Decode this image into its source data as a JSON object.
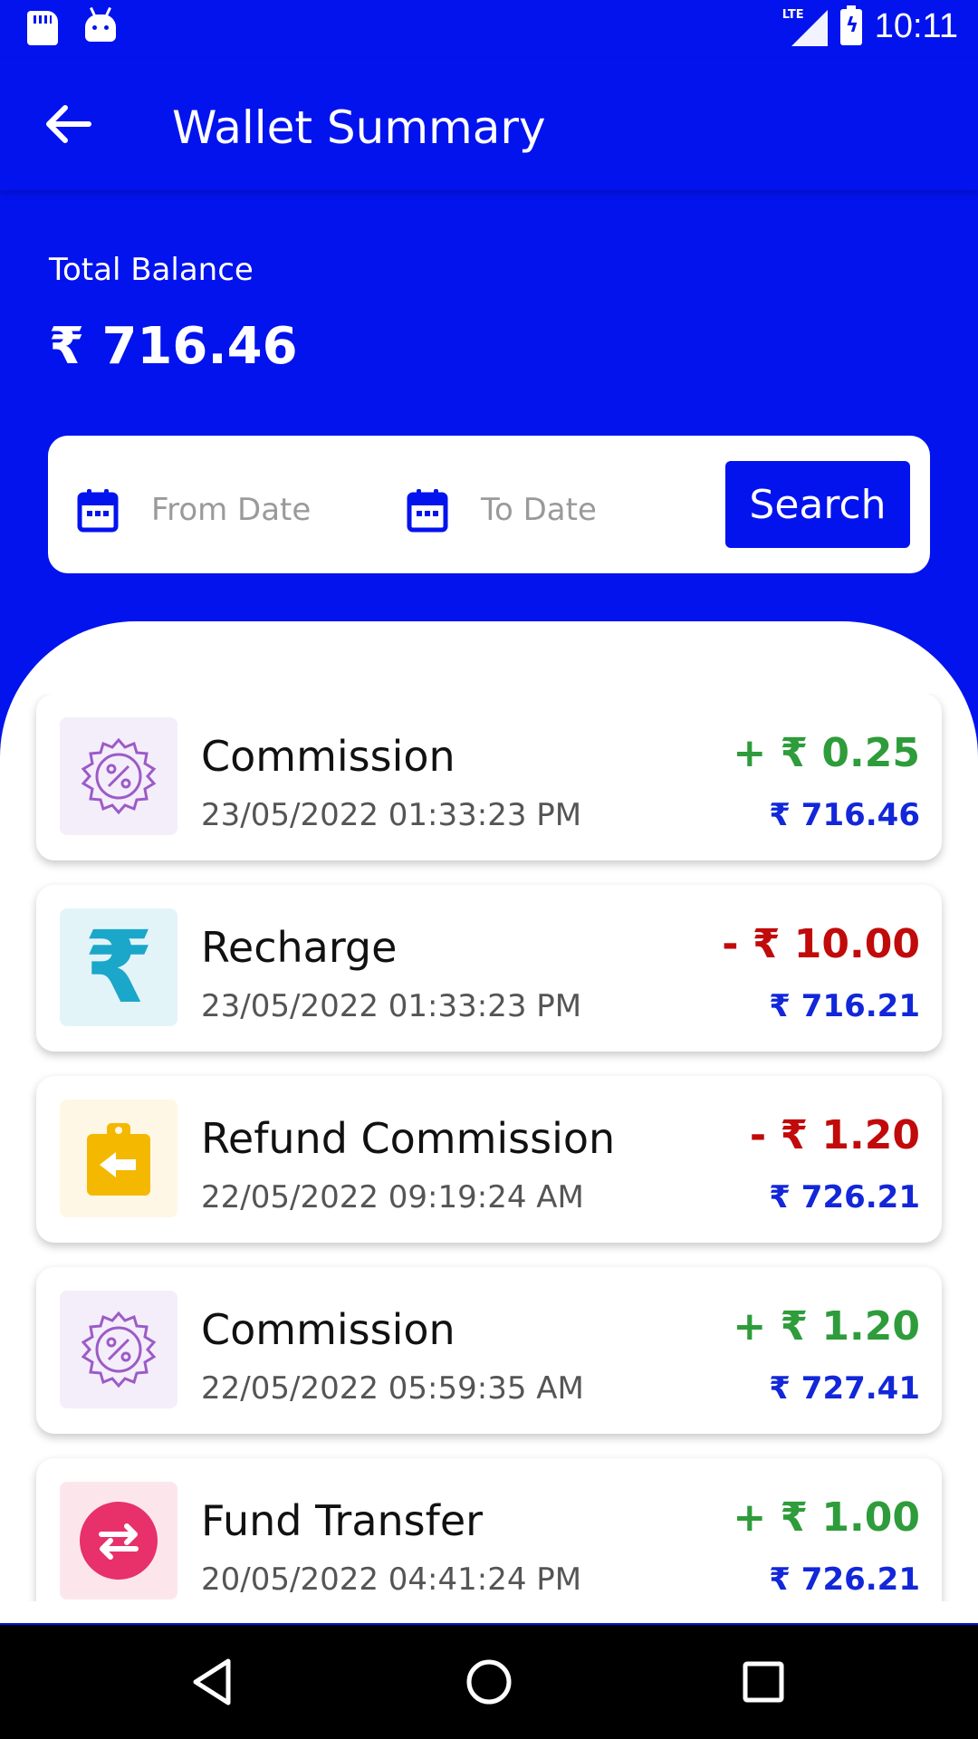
{
  "status_bar": {
    "time": "10:11",
    "network": "LTE",
    "icons": [
      "sd-card-icon",
      "android-icon",
      "lte-signal-icon",
      "battery-charging-icon"
    ]
  },
  "app_bar": {
    "title": "Wallet Summary",
    "back_icon": "arrow-left-icon"
  },
  "balance": {
    "label": "Total Balance",
    "value": "₹ 716.46"
  },
  "filter": {
    "from_placeholder": "From Date",
    "to_placeholder": "To Date",
    "search_label": "Search"
  },
  "colors": {
    "primary": "#0313EE",
    "credit": "#2E9C3A",
    "debit": "#C10A0A",
    "balance_text": "#1227D9"
  },
  "transactions": [
    {
      "title": "Commission",
      "datetime": "23/05/2022 01:33:23 PM",
      "amount": "+ ₹ 0.25",
      "balance": "₹ 716.46",
      "type": "credit",
      "icon": "commission-percent-icon"
    },
    {
      "title": "Recharge",
      "datetime": "23/05/2022 01:33:23 PM",
      "amount": "- ₹ 10.00",
      "balance": "₹ 716.21",
      "type": "debit",
      "icon": "rupee-icon"
    },
    {
      "title": "Refund Commission",
      "datetime": "22/05/2022 09:19:24 AM",
      "amount": "- ₹ 1.20",
      "balance": "₹ 726.21",
      "type": "debit",
      "icon": "refund-clipboard-icon"
    },
    {
      "title": "Commission",
      "datetime": "22/05/2022 05:59:35 AM",
      "amount": "+ ₹ 1.20",
      "balance": "₹ 727.41",
      "type": "credit",
      "icon": "commission-percent-icon"
    },
    {
      "title": "Fund Transfer",
      "datetime": "20/05/2022 04:41:24 PM",
      "amount": "+ ₹ 1.00",
      "balance": "₹ 726.21",
      "type": "credit",
      "icon": "transfer-arrows-icon"
    }
  ],
  "nav_bar": {
    "buttons": [
      "back-triangle-icon",
      "home-circle-icon",
      "recents-square-icon"
    ]
  }
}
